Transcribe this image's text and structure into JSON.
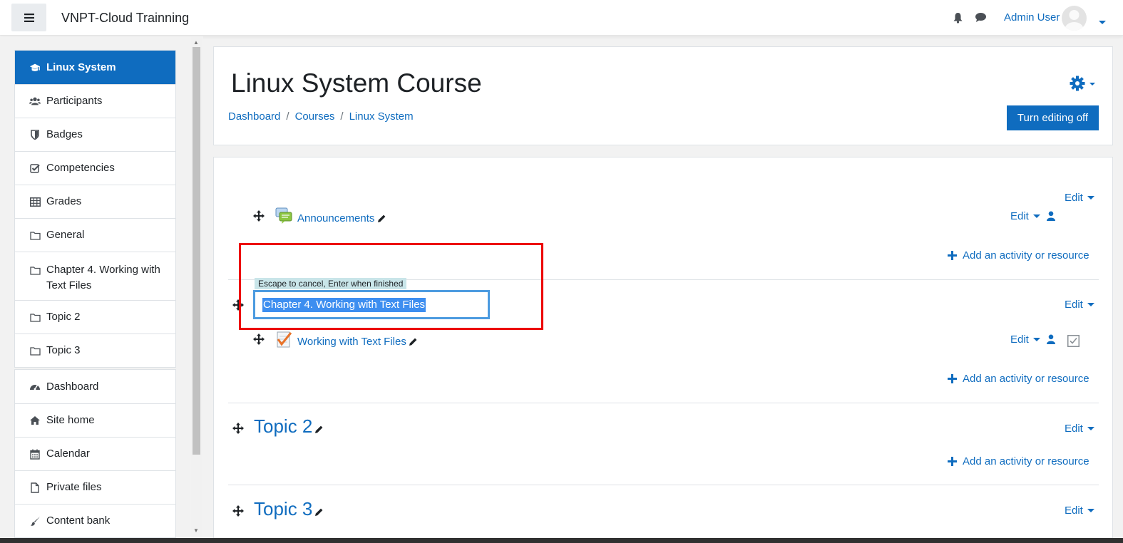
{
  "navbar": {
    "site_name": "VNPT-Cloud Trainning",
    "user_name": "Admin User",
    "menu_icon": "hamburger-icon",
    "notification_icon": "bell-icon",
    "messages_icon": "chat-icon"
  },
  "drawer": {
    "course_items": [
      {
        "label": "Linux System",
        "icon": "graduation-cap-icon",
        "active": true
      },
      {
        "label": "Participants",
        "icon": "users-icon"
      },
      {
        "label": "Badges",
        "icon": "shield-icon"
      },
      {
        "label": "Competencies",
        "icon": "check-square-icon"
      },
      {
        "label": "Grades",
        "icon": "table-icon"
      },
      {
        "label": "General",
        "icon": "folder-icon"
      },
      {
        "label": "Chapter 4. Working with Text Files",
        "icon": "folder-icon"
      },
      {
        "label": "Topic 2",
        "icon": "folder-icon"
      },
      {
        "label": "Topic 3",
        "icon": "folder-icon"
      }
    ],
    "site_items": [
      {
        "label": "Dashboard",
        "icon": "dashboard-icon"
      },
      {
        "label": "Site home",
        "icon": "home-icon"
      },
      {
        "label": "Calendar",
        "icon": "calendar-icon"
      },
      {
        "label": "Private files",
        "icon": "file-icon"
      },
      {
        "label": "Content bank",
        "icon": "brush-icon"
      }
    ]
  },
  "header": {
    "title": "Linux System Course",
    "breadcrumb": [
      "Dashboard",
      "Courses",
      "Linux System"
    ],
    "separator": "/",
    "turn_editing_label": "Turn editing off"
  },
  "sections": {
    "edit_label": "Edit",
    "add_activity_label": "Add an activity or resource",
    "general": {
      "activity": "Announcements"
    },
    "chapter4": {
      "inplace_hint": "Escape to cancel, Enter when finished",
      "inplace_value": "Chapter 4. Working with Text Files",
      "activity": "Working with Text Files"
    },
    "topic2": {
      "title": "Topic 2"
    },
    "topic3": {
      "title": "Topic 3"
    }
  },
  "colors": {
    "brand": "#0f6cbf",
    "highlight_box": "#ec0000",
    "selection": "#3d8ef0"
  }
}
